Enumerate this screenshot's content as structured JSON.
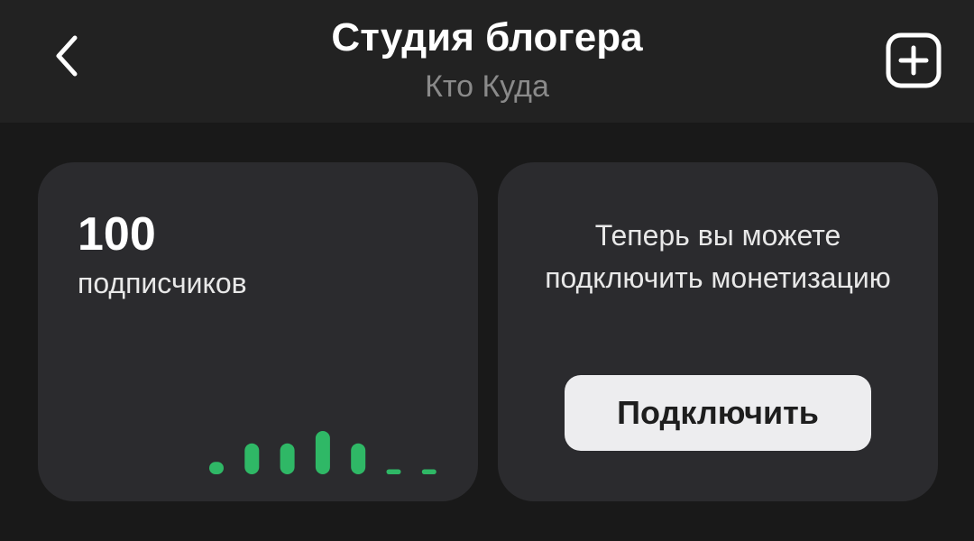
{
  "header": {
    "title": "Студия блогера",
    "subtitle": "Кто Куда",
    "back_icon": "chevron-left-icon",
    "add_icon": "plus-square-icon"
  },
  "stats_card": {
    "value": "100",
    "label": "подписчиков",
    "chart_data": {
      "type": "bar",
      "values": [
        2,
        5,
        5,
        7,
        5,
        0.8,
        0.8
      ],
      "color": "#2fb866"
    }
  },
  "monetization_card": {
    "text": "Теперь вы можете подключить монетизацию",
    "button_label": "Подключить"
  },
  "colors": {
    "background": "#191919",
    "header": "#222222",
    "card": "#2b2b2e",
    "accent_green": "#2fb866",
    "button_bg": "#ededef"
  }
}
